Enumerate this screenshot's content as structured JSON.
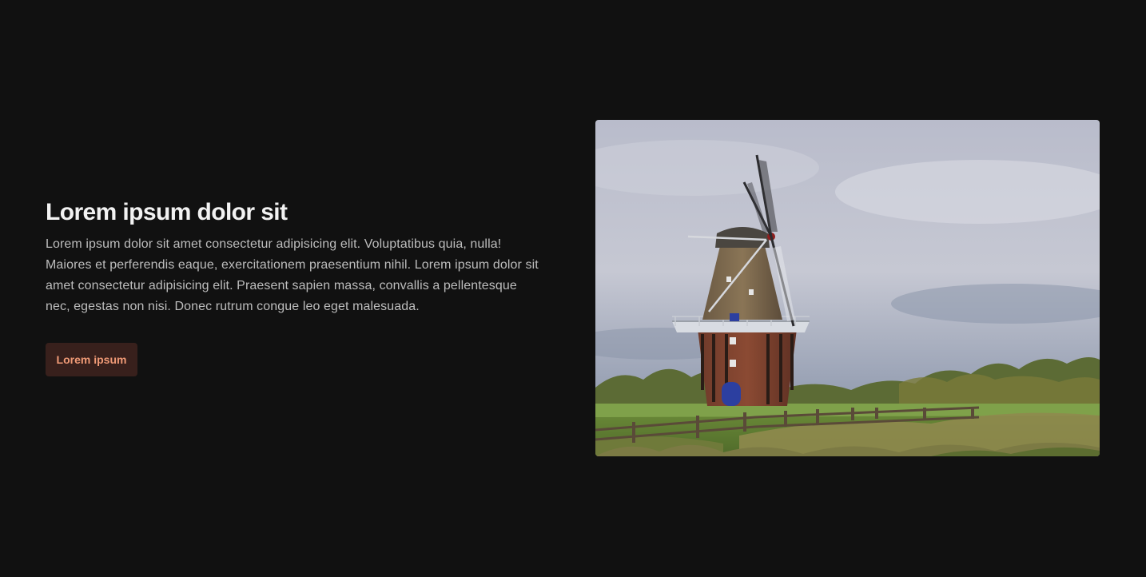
{
  "hero": {
    "title": "Lorem ipsum dolor sit",
    "description": "Lorem ipsum dolor sit amet consectetur adipisicing elit. Voluptatibus quia, nulla! Maiores et perferendis eaque, exercitationem praesentium nihil. Lorem ipsum dolor sit amet consectetur adipisicing elit. Praesent sapien massa, convallis a pellentesque nec, egestas non nisi. Donec rutrum congue leo eget malesuada.",
    "button_label": "Lorem ipsum"
  },
  "colors": {
    "background": "#111111",
    "title": "#f2f2f2",
    "body_text": "#bdbdbd",
    "button_bg": "#38201c",
    "button_text": "#f09a76"
  },
  "image": {
    "subject": "windmill-photo"
  }
}
